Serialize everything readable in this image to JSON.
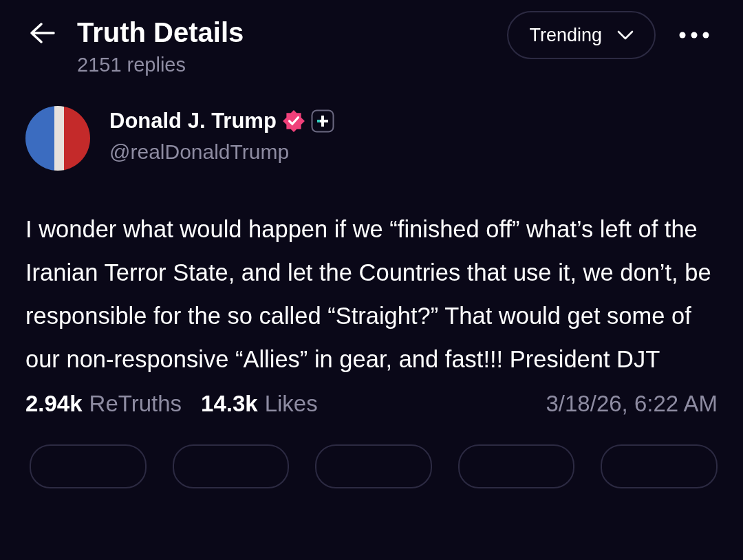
{
  "header": {
    "title": "Truth Details",
    "subtitle": "2151 replies",
    "sort_label": "Trending"
  },
  "author": {
    "name": "Donald J. Trump",
    "handle": "@realDonaldTrump",
    "verified": true
  },
  "post": {
    "text": "I wonder what would happen if we “finished off” what’s left of the Iranian Terror State, and let the Countries that use it, we don’t, be responsible for the so called “Straight?” That would get some of our non-responsive “Allies” in gear, and fast!!! President DJT"
  },
  "stats": [
    {
      "count": "2.94k",
      "label": "ReTruths"
    },
    {
      "count": "14.3k",
      "label": "Likes"
    }
  ],
  "timestamp": "3/18/26, 6:22 AM"
}
